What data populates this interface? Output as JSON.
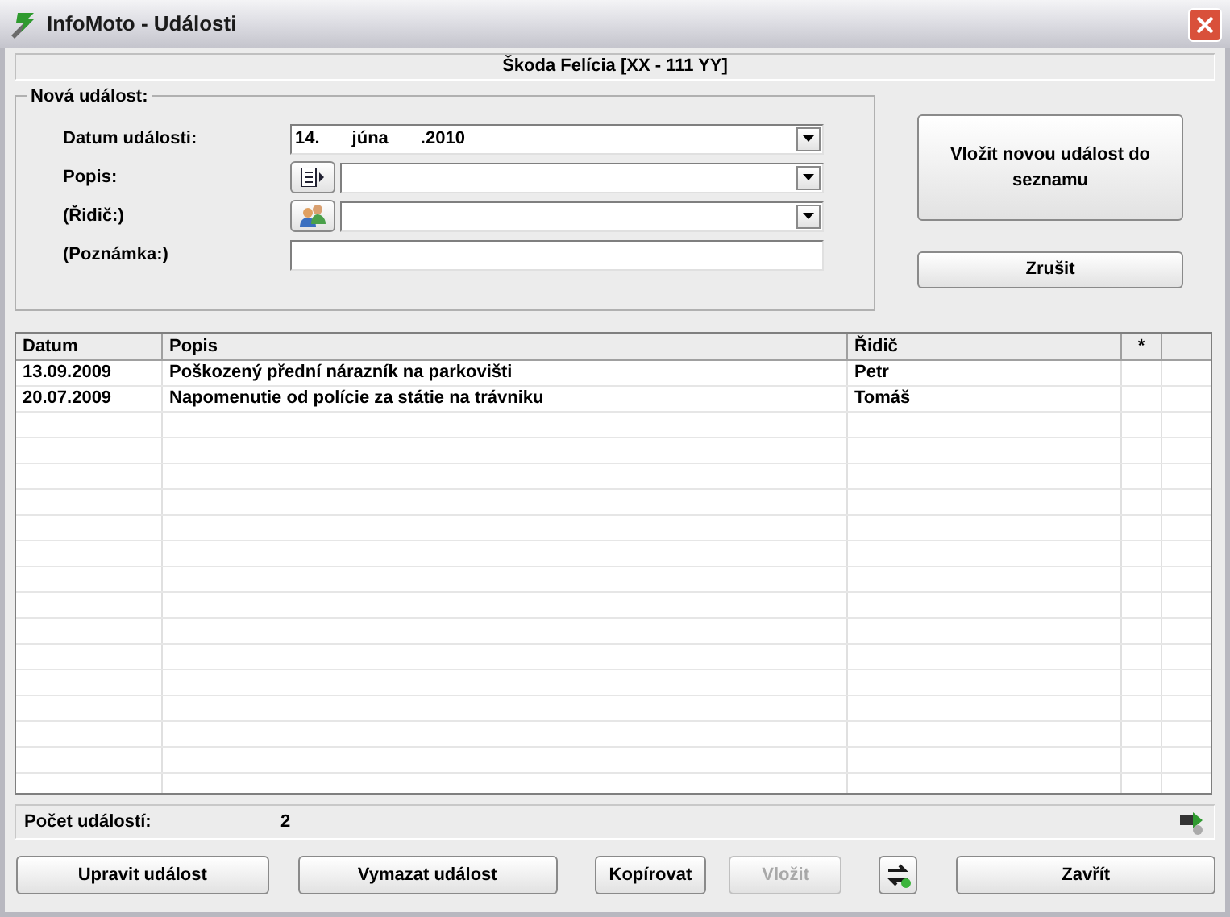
{
  "window": {
    "title": "InfoMoto - Události"
  },
  "vehicle": "Škoda Felícia [XX - 111 YY]",
  "form": {
    "title": "Nová událost:",
    "fields": [
      {
        "label": "Datum události:",
        "kind": "combo",
        "value": [
          "14.",
          "júna",
          ".2010"
        ]
      },
      {
        "label": "Popis:",
        "kind": "combo_button"
      },
      {
        "label": "(Řidič:)",
        "kind": "combo_people"
      },
      {
        "label": "(Poznámka:)",
        "kind": "input"
      }
    ]
  },
  "side_buttons": [
    "Vložit novou událost do seznamu",
    "Zrušit"
  ],
  "table": {
    "columns": [
      "Datum",
      "Popis",
      "Řidič",
      "*"
    ],
    "rows": [
      [
        "13.09.2009",
        "Poškozený přední nárazník na parkovišti",
        "Petr",
        ""
      ],
      [
        "20.07.2009",
        "Napomenutie od polície za státie na trávniku",
        "Tomáš",
        ""
      ]
    ]
  },
  "status": {
    "label": "Počet událostí:",
    "value": "2"
  },
  "buttons": [
    {
      "kind": "text",
      "label": "Upravit událost",
      "disabled": false
    },
    {
      "kind": "text",
      "label": "Vymazat událost",
      "disabled": false
    },
    {
      "kind": "text",
      "label": "Kopírovat",
      "disabled": false
    },
    {
      "kind": "text",
      "label": "Vložit",
      "disabled": true
    },
    {
      "kind": "icon",
      "disabled": false
    },
    {
      "kind": "text",
      "label": "Zavřít",
      "disabled": false
    }
  ]
}
